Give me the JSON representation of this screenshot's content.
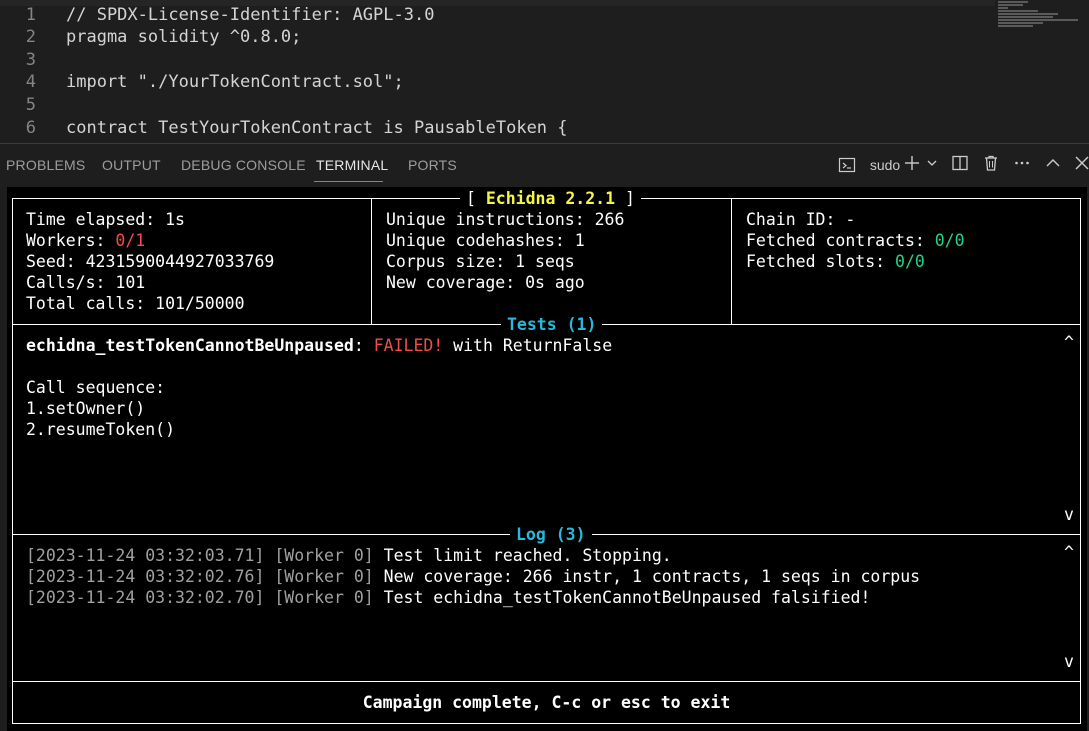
{
  "editor": {
    "lines": [
      {
        "n": "1",
        "text": "// SPDX-License-Identifier: AGPL-3.0"
      },
      {
        "n": "2",
        "text": "pragma solidity ^0.8.0;"
      },
      {
        "n": "3",
        "text": ""
      },
      {
        "n": "4",
        "text": "import \"./YourTokenContract.sol\";"
      },
      {
        "n": "5",
        "text": ""
      },
      {
        "n": "6",
        "text": "contract TestYourTokenContract is PausableToken {"
      }
    ]
  },
  "panel": {
    "tabs": [
      "PROBLEMS",
      "OUTPUT",
      "DEBUG CONSOLE",
      "TERMINAL",
      "PORTS"
    ],
    "active_tab": "TERMINAL",
    "terminal_name": "sudo",
    "icons": [
      "terminal-icon",
      "plus-icon",
      "chevron-down-icon",
      "split-icon",
      "trash-icon",
      "more-icon",
      "maximize-icon",
      "close-icon"
    ]
  },
  "echidna": {
    "title": "Echidna 2.2.1",
    "status": {
      "time_elapsed_label": "Time elapsed: ",
      "time_elapsed": "1s",
      "workers_label": "Workers: ",
      "workers": "0/1",
      "seed_label": "Seed: ",
      "seed": "4231590044927033769",
      "calls_per_s_label": "Calls/s: ",
      "calls_per_s": "101",
      "total_calls_label": "Total calls: ",
      "total_calls": "101/50000",
      "unique_instructions_label": "Unique instructions: ",
      "unique_instructions": "266",
      "unique_codehashes_label": "Unique codehashes: ",
      "unique_codehashes": "1",
      "corpus_size_label": "Corpus size: ",
      "corpus_size": "1 seqs",
      "new_coverage_label": "New coverage: ",
      "new_coverage": "0s ago",
      "chain_id_label": "Chain ID: ",
      "chain_id": "-",
      "fetched_contracts_label": "Fetched contracts: ",
      "fetched_contracts": "0/0",
      "fetched_slots_label": "Fetched slots: ",
      "fetched_slots": "0/0"
    },
    "tests": {
      "title": "Tests (1)",
      "name": "echidna_testTokenCannotBeUnpaused",
      "colon": ": ",
      "result": "FAILED!",
      "with": " with ReturnFalse",
      "call_sequence_label": "Call sequence:",
      "calls": [
        "1.setOwner()",
        "2.resumeToken()"
      ]
    },
    "log": {
      "title": "Log (3)",
      "entries": [
        {
          "time": "[2023-11-24 03:32:03.71]",
          "worker": "[Worker 0]",
          "msg": "Test limit reached. Stopping."
        },
        {
          "time": "[2023-11-24 03:32:02.76]",
          "worker": "[Worker 0]",
          "msg": "New coverage: 266 instr, 1 contracts, 1 seqs in corpus"
        },
        {
          "time": "[2023-11-24 03:32:02.70]",
          "worker": "[Worker 0]",
          "msg": "Test echidna_testTokenCannotBeUnpaused falsified!"
        }
      ]
    },
    "scroll_up": "^",
    "scroll_down": "v",
    "footer": "Campaign complete, C-c or esc to exit"
  }
}
